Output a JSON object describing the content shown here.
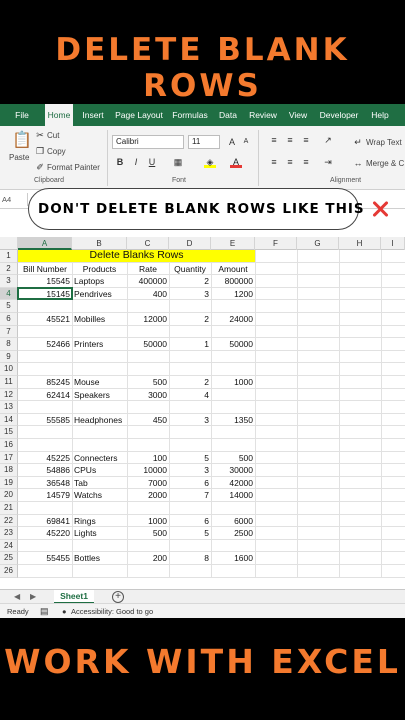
{
  "headline_top": "DELETE BLANK ROWS",
  "headline_bottom": "WORK WITH EXCEL",
  "banner": {
    "text": "DON'T DELETE BLANK ROWS LIKE THIS",
    "icon": "cross-mark-icon"
  },
  "menu": [
    "File",
    "Home",
    "Insert",
    "Page Layout",
    "Formulas",
    "Data",
    "Review",
    "View",
    "Developer",
    "Help"
  ],
  "ribbon": {
    "cut": "Cut",
    "copy": "Copy",
    "format_painter": "Format Painter",
    "paste": "Paste",
    "clipboard_label": "Clipboard",
    "font_name": "Calibri",
    "font_size": "11",
    "font_label": "Font",
    "wrap_text": "Wrap Text",
    "merge": "Merge & C",
    "alignment_label": "Alignment",
    "bold": "B",
    "italic": "I",
    "underline": "U"
  },
  "name_box": "A4",
  "grid": {
    "columns": [
      "A",
      "B",
      "C",
      "D",
      "E",
      "F",
      "G",
      "H",
      "I"
    ],
    "title": "Delete Blanks Rows",
    "headers": [
      "Bill Number",
      "Products",
      "Rate",
      "Quantity",
      "Amount"
    ],
    "rows": [
      {
        "n": "3",
        "cells": [
          "15545",
          "Laptops",
          "400000",
          "2",
          "800000"
        ]
      },
      {
        "n": "4",
        "cells": [
          "15145",
          "Pendrives",
          "400",
          "3",
          "1200"
        ]
      },
      {
        "n": "5",
        "cells": [
          "",
          "",
          "",
          "",
          ""
        ]
      },
      {
        "n": "6",
        "cells": [
          "45521",
          "Mobilles",
          "12000",
          "2",
          "24000"
        ]
      },
      {
        "n": "7",
        "cells": [
          "",
          "",
          "",
          "",
          ""
        ]
      },
      {
        "n": "8",
        "cells": [
          "52466",
          "Printers",
          "50000",
          "1",
          "50000"
        ]
      },
      {
        "n": "9",
        "cells": [
          "",
          "",
          "",
          "",
          ""
        ]
      },
      {
        "n": "10",
        "cells": [
          "",
          "",
          "",
          "",
          ""
        ]
      },
      {
        "n": "11",
        "cells": [
          "85245",
          "Mouse",
          "500",
          "2",
          "1000"
        ]
      },
      {
        "n": "12",
        "cells": [
          "62414",
          "Speakers",
          "3000",
          "4",
          ""
        ]
      },
      {
        "n": "13",
        "cells": [
          "",
          "",
          "",
          "",
          ""
        ]
      },
      {
        "n": "14",
        "cells": [
          "55585",
          "Headphones",
          "450",
          "3",
          "1350"
        ]
      },
      {
        "n": "15",
        "cells": [
          "",
          "",
          "",
          "",
          ""
        ]
      },
      {
        "n": "16",
        "cells": [
          "",
          "",
          "",
          "",
          ""
        ]
      },
      {
        "n": "17",
        "cells": [
          "45225",
          "Connecters",
          "100",
          "5",
          "500"
        ]
      },
      {
        "n": "18",
        "cells": [
          "54886",
          "CPUs",
          "10000",
          "3",
          "30000"
        ]
      },
      {
        "n": "19",
        "cells": [
          "36548",
          "Tab",
          "7000",
          "6",
          "42000"
        ]
      },
      {
        "n": "20",
        "cells": [
          "14579",
          "Watchs",
          "2000",
          "7",
          "14000"
        ]
      },
      {
        "n": "21",
        "cells": [
          "",
          "",
          "",
          "",
          ""
        ]
      },
      {
        "n": "22",
        "cells": [
          "69841",
          "Rings",
          "1000",
          "6",
          "6000"
        ]
      },
      {
        "n": "23",
        "cells": [
          "45220",
          "Lights",
          "500",
          "5",
          "2500"
        ]
      },
      {
        "n": "24",
        "cells": [
          "",
          "",
          "",
          "",
          ""
        ]
      },
      {
        "n": "25",
        "cells": [
          "55455",
          "Bottles",
          "200",
          "8",
          "1600"
        ]
      },
      {
        "n": "26",
        "cells": [
          "",
          "",
          "",
          "",
          ""
        ]
      }
    ]
  },
  "sheet_tab": "Sheet1",
  "status": {
    "ready": "Ready",
    "accessibility": "Accessibility: Good to go"
  }
}
